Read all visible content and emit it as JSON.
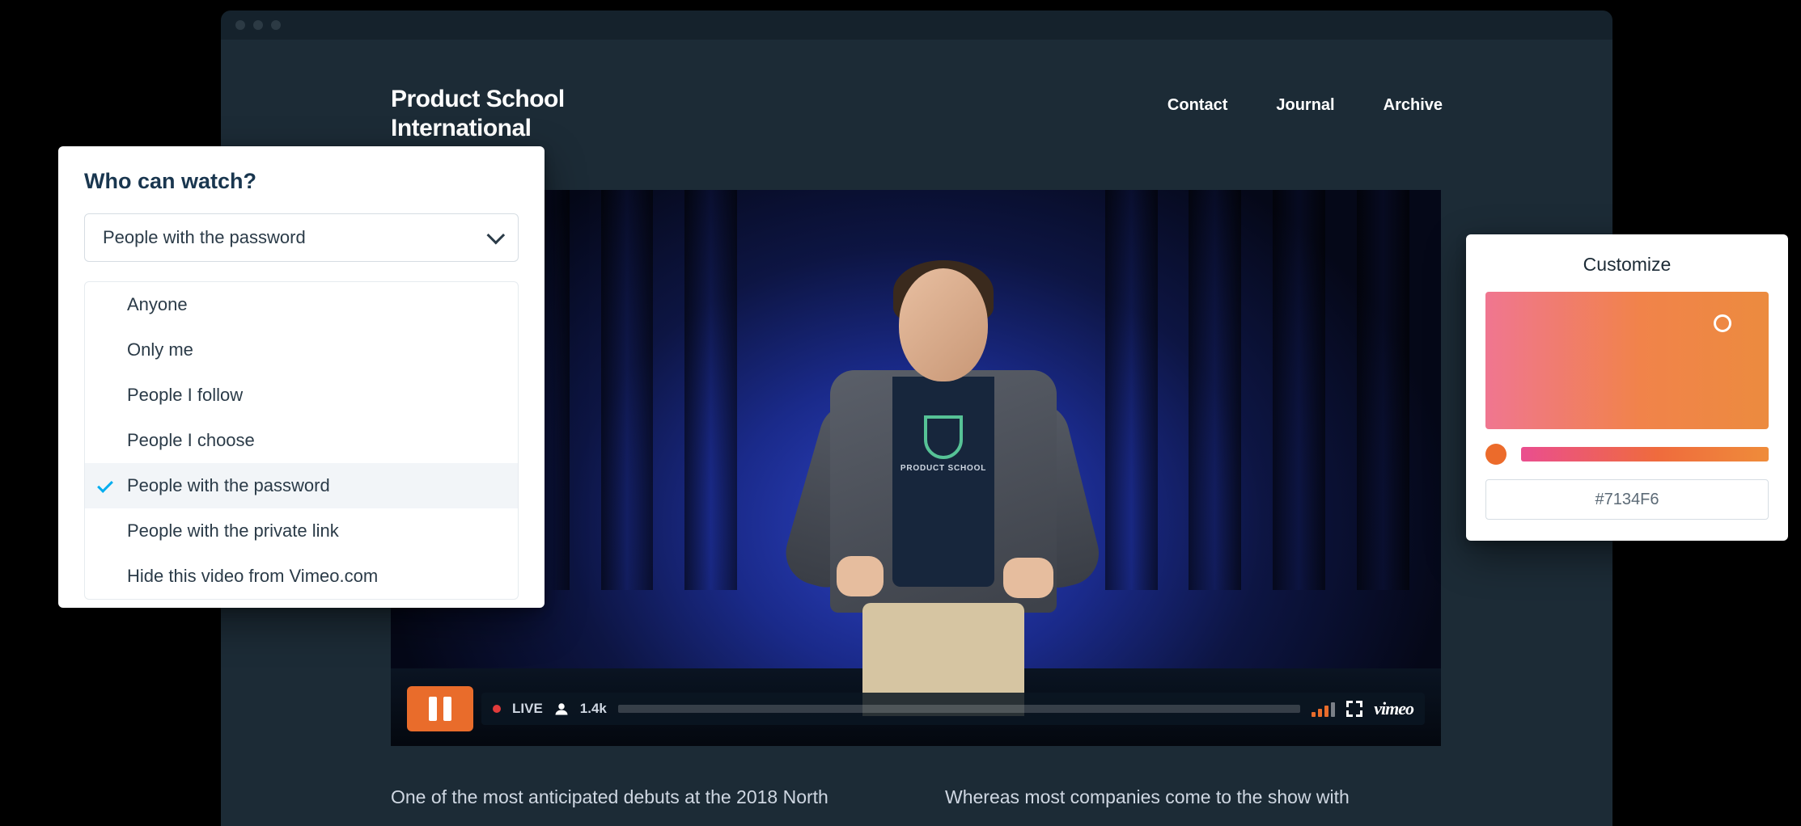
{
  "site": {
    "brand_line1": "Product School",
    "brand_line2": "International",
    "nav": [
      "Contact",
      "Journal",
      "Archive"
    ]
  },
  "player": {
    "live_label": "LIVE",
    "viewers": "1.4k",
    "vimeo_label": "vimeo",
    "shirt_text": "PRODUCT SCHOOL"
  },
  "article": {
    "col1": "One of the most anticipated debuts at the 2018 North",
    "col2": "Whereas most companies come to the show with"
  },
  "privacy": {
    "title": "Who can watch?",
    "selected": "People with the password",
    "options": [
      "Anyone",
      "Only me",
      "People I follow",
      "People I choose",
      "People with the password",
      "People with the private link",
      "Hide this video from Vimeo.com"
    ],
    "selected_index": 4
  },
  "customize": {
    "title": "Customize",
    "hex": "#7134F6"
  }
}
